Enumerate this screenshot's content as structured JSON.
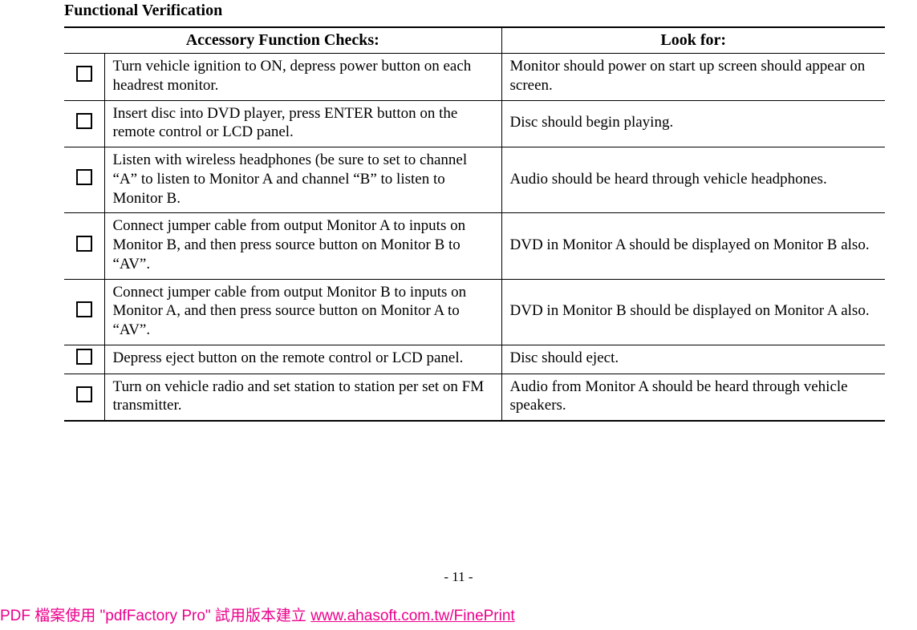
{
  "section_title": "Functional Verification",
  "headers": {
    "checks": "Accessory Function Checks:",
    "look": "Look for:"
  },
  "rows": [
    {
      "check": "Turn vehicle ignition to ON, depress power button on each headrest monitor.",
      "look": "Monitor should power on start up screen should appear on screen."
    },
    {
      "check": "Insert disc into DVD player, press ENTER button on the remote control or LCD panel.",
      "look": "Disc should begin playing."
    },
    {
      "check": "Listen with wireless headphones (be sure to set to channel “A” to listen to Monitor A and channel “B” to listen to Monitor B.",
      "look": "Audio should be heard through vehicle headphones."
    },
    {
      "check": "Connect jumper cable from output Monitor A to inputs on Monitor B, and then press source button on Monitor B to “AV”.",
      "look": "DVD in Monitor A should be displayed on Monitor B also."
    },
    {
      "check": "Connect jumper cable from output Monitor B to inputs on Monitor A, and then press source button on Monitor A to “AV”.",
      "look": "DVD in Monitor B should be displayed on Monitor A also."
    },
    {
      "check": "Depress eject button on the remote control or LCD panel.",
      "look": "Disc should eject."
    },
    {
      "check": "Turn on vehicle radio and set station to station per set on FM transmitter.",
      "look": "Audio from Monitor A should be heard through vehicle speakers."
    }
  ],
  "page_number": "- 11 -",
  "footer": {
    "prefix": "PDF 檔案使用 \"pdfFactory Pro\" 試用版本建立 ",
    "link_text": "www.ahasoft.com.tw/FinePrint"
  }
}
